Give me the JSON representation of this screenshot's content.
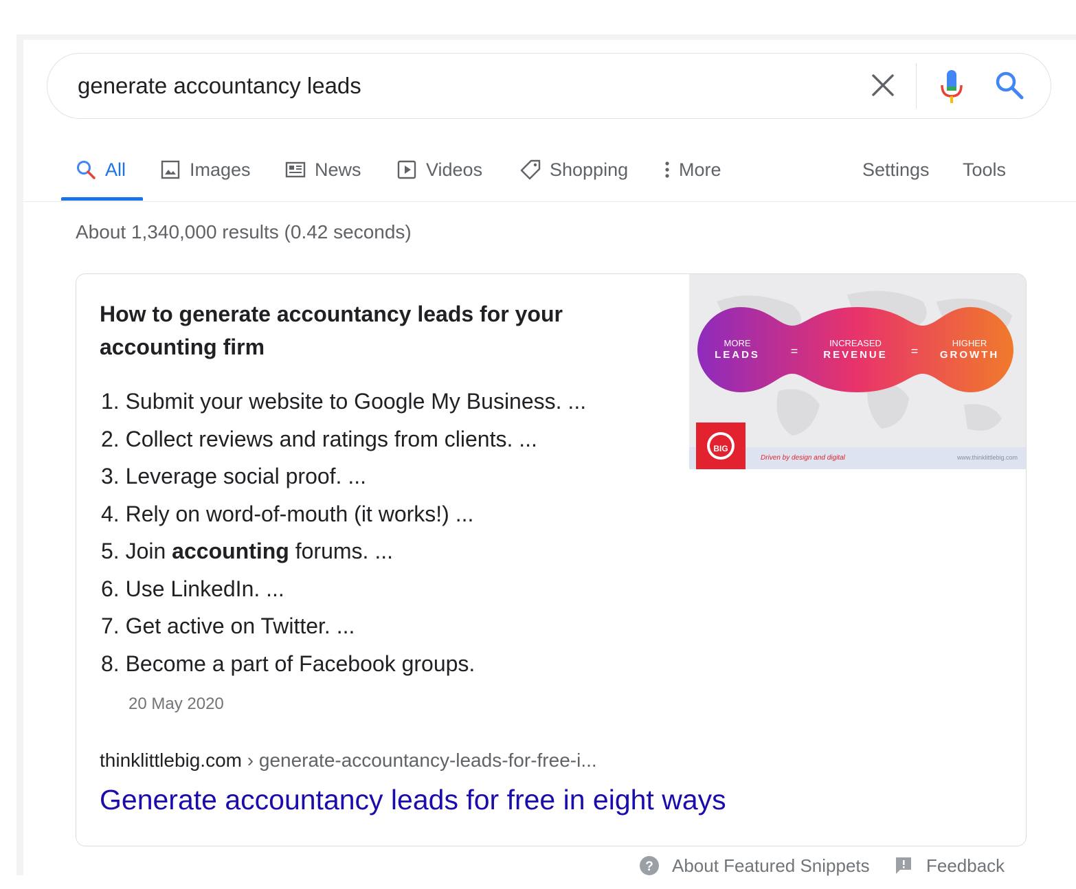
{
  "search": {
    "query": "generate accountancy leads"
  },
  "tabs": [
    {
      "label": "All",
      "icon": "search-icon"
    },
    {
      "label": "Images",
      "icon": "image-icon"
    },
    {
      "label": "News",
      "icon": "news-icon"
    },
    {
      "label": "Videos",
      "icon": "play-icon"
    },
    {
      "label": "Shopping",
      "icon": "tag-icon"
    },
    {
      "label": "More",
      "icon": "more-vert-icon"
    }
  ],
  "tools": {
    "settings_label": "Settings",
    "tools_label": "Tools"
  },
  "result_stats": "About 1,340,000 results (0.42 seconds)",
  "featured_snippet": {
    "title": "How to generate accountancy leads for your accounting firm",
    "items": [
      {
        "number": "1.",
        "before": "Submit your website to Google My Business. ...",
        "bold": "",
        "after": ""
      },
      {
        "number": "2.",
        "before": "Collect reviews and ratings from clients. ...",
        "bold": "",
        "after": ""
      },
      {
        "number": "3.",
        "before": "Leverage social proof. ...",
        "bold": "",
        "after": ""
      },
      {
        "number": "4.",
        "before": "Rely on word-of-mouth (it works!) ...",
        "bold": "",
        "after": ""
      },
      {
        "number": "5.",
        "before": "Join ",
        "bold": "accounting",
        "after": " forums. ..."
      },
      {
        "number": "6.",
        "before": "Use LinkedIn. ...",
        "bold": "",
        "after": ""
      },
      {
        "number": "7.",
        "before": "Get active on Twitter. ...",
        "bold": "",
        "after": ""
      },
      {
        "number": "8.",
        "before": "Become a part of Facebook groups.",
        "bold": "",
        "after": ""
      }
    ],
    "date": "20 May 2020",
    "image": {
      "bubbles": [
        {
          "top": "MORE",
          "bottom": "LEADS"
        },
        {
          "top": "INCREASED",
          "bottom": "REVENUE"
        },
        {
          "top": "HIGHER",
          "bottom": "GROWTH"
        }
      ],
      "equals": "=",
      "logo_text": "BIG",
      "tagline": "Driven by design and digital",
      "site": "www.thinklittlebig.com"
    },
    "cite_domain": "thinklittlebig.com",
    "cite_path": " › generate-accountancy-leads-for-free-i...",
    "link_title": "Generate accountancy leads for free in eight ways"
  },
  "footer": {
    "about_label": "About Featured Snippets",
    "feedback_label": "Feedback"
  },
  "colors": {
    "accent_blue": "#1a73e8",
    "link_blue": "#1a0dab",
    "gradient_start": "#8e2bbd",
    "gradient_mid": "#e8336b",
    "gradient_end": "#f07a2c"
  }
}
